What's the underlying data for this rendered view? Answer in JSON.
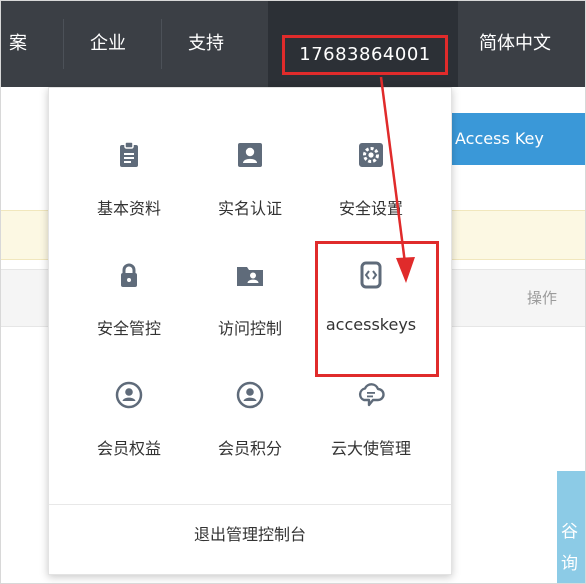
{
  "header": {
    "nav_items": [
      {
        "label": "案"
      },
      {
        "label": "企业"
      },
      {
        "label": "支持"
      },
      {
        "label": "17683864001"
      },
      {
        "label": "简体中文"
      }
    ]
  },
  "page": {
    "access_key_button": "Access Key",
    "table_header_action": "操作",
    "side_widget_chars": [
      "谷",
      "询"
    ]
  },
  "dropdown": {
    "items": [
      {
        "label": "基本资料",
        "icon": "clipboard-icon"
      },
      {
        "label": "实名认证",
        "icon": "id-card-icon"
      },
      {
        "label": "安全设置",
        "icon": "gear-icon"
      },
      {
        "label": "安全管控",
        "icon": "lock-icon"
      },
      {
        "label": "访问控制",
        "icon": "folder-user-icon"
      },
      {
        "label": "accesskeys",
        "icon": "code-brackets-icon"
      },
      {
        "label": "会员权益",
        "icon": "user-circle-icon"
      },
      {
        "label": "会员积分",
        "icon": "user-circle-icon"
      },
      {
        "label": "云大使管理",
        "icon": "cloud-chat-icon"
      }
    ],
    "logout_label": "退出管理控制台"
  },
  "colors": {
    "topbar": "#3b3f45",
    "accent_blue": "#3a98d8",
    "annotation_red": "#e02b2b",
    "icon_gray": "#5f6b7a"
  }
}
